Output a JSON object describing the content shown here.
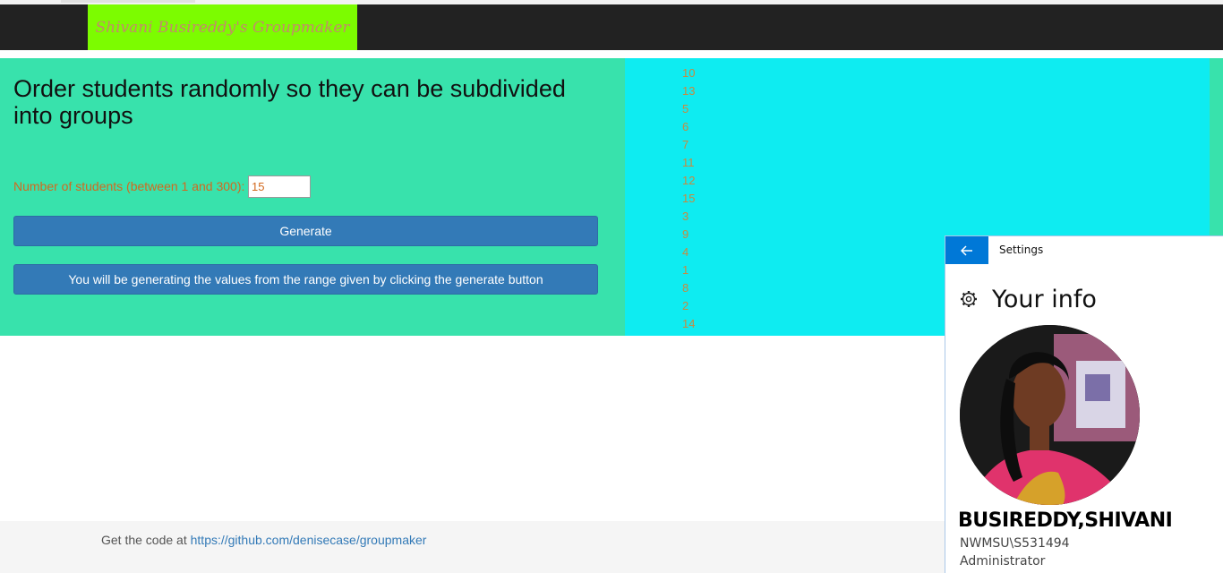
{
  "navbar": {
    "brand": "Shivani Busireddy's Groupmaker"
  },
  "main": {
    "headline": "Order students randomly so they can be subdivided into groups",
    "count_label": "Number of students (between 1 and 300):",
    "count_value": "15",
    "generate_button": "Generate",
    "info_button": "You will be generating the values from the range given by clicking the generate button"
  },
  "results": {
    "numbers": [
      "10",
      "13",
      "5",
      "6",
      "7",
      "11",
      "12",
      "15",
      "3",
      "9",
      "4",
      "1",
      "8",
      "2",
      "14"
    ]
  },
  "footer": {
    "prefix": "Get the code at",
    "link": "https://github.com/denisecase/groupmaker"
  },
  "settings": {
    "title": "Settings",
    "heading": "Your info",
    "user_name": "BUSIREDDY,SHIVANI",
    "account": "NWMSU\\S531494",
    "role": "Administrator",
    "icons": [
      "back-arrow-icon",
      "gear-icon",
      "avatar"
    ]
  },
  "colors": {
    "navbar": "#222222",
    "brand_bg": "#7cfc00",
    "left_panel": "#38e2ac",
    "right_panel": "#0eecf1",
    "button": "#337ab7",
    "settings_accent": "#0078d7"
  }
}
